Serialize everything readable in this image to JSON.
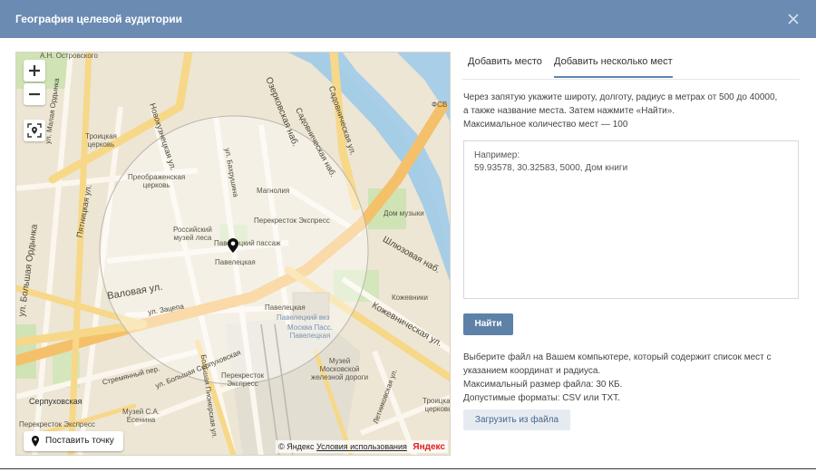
{
  "header": {
    "title": "География целевой аудитории",
    "close_icon": "close-icon"
  },
  "colors": {
    "header_bg": "#6b8bb3",
    "accent": "#5e81a8",
    "secondary_button_bg": "#e5ebf1",
    "yandex_red": "#e01e1e"
  },
  "map": {
    "zoom_in_icon": "plus-icon",
    "zoom_out_icon": "minus-icon",
    "locate_icon": "location-target-icon",
    "place_point_label": "Поставить точку",
    "attribution_prefix": "© Яндекс",
    "terms_label": "Условия использования",
    "brand": "Яндекс",
    "labels": {
      "ostrovskogo": "А.Н. Островского",
      "malaya_ordynka": "ул. Малая Ордынка",
      "troitskaya": "Троицкая\nцерковь",
      "preobr": "Преображенская\nцерковь",
      "magnolia": "Магнолия",
      "perekrestok1": "Перекресток Экспресс",
      "museum_forest": "Российский\nмузей леса",
      "paveletsky_passage": "Павелецкий пассаж",
      "paveletskaya": "Павелецкая",
      "paveletskaya2": "Павелецкая",
      "paveletsky_vokzal": "Павелецкий вкз",
      "moskva_pass": "Москва Пасс.\nПавелецкая",
      "dom_muzyki": "Дом музыки",
      "kozhevniki": "Кожевники",
      "fsv": "ФСВ",
      "museum_rail": "Музей\nМосковской\nжелезной дороги",
      "perekrestok2": "Перекресток\nЭкспресс",
      "serpukhovskaya": "Серпуховская",
      "perekrestok3": "Перекресток Экспресс",
      "museum_esenina": "Музей С.А.\nЕсенина",
      "troitskaya2": "Троицкая\nцерковь"
    },
    "roads": {
      "valovaya": "Валовая ул.",
      "novokuznetskaya": "Новокузнецкая ул.",
      "pyatnitskaya": "Пятницкая ул.",
      "bolshaya_ordynka": "ул. Большая Ордынка",
      "ozerkovskaya": "Озерковская наб.",
      "sadovnicheskaya": "Садовническая ул.",
      "sadovnicheskaya_nab": "Садовническая наб.",
      "shlyuzovaya": "Шлюзовая наб.",
      "kozhevnicheskaya": "Кожевническая ул.",
      "bakhrushina": "ул. Бахрушина",
      "zatsepa": "ул. Зацепа",
      "stremyanny": "Стремянный пер.",
      "bolshaya_serpukhovskaya": "ул. Большая Серпуховская",
      "letnikovskaya": "Летниковская ул.",
      "bolshaya_pionerskaya": "Большая Пионерская ул."
    }
  },
  "tabs": [
    {
      "label": "Добавить место",
      "active": false
    },
    {
      "label": "Добавить несколько мест",
      "active": true
    }
  ],
  "instructions": {
    "line1": "Через запятую укажите широту, долготу, радиус в метрах от 500 до 40000,",
    "line2": "а также название места. Затем нажмите «Найти».",
    "line3": "Максимальное количество мест — 100"
  },
  "textarea": {
    "placeholder_line1": "Например:",
    "placeholder_line2": "59.93578, 30.32583, 5000, Дом книги"
  },
  "find_button": "Найти",
  "file_info": {
    "line1": "Выберите файл на Вашем компьютере, который содержит список мест с",
    "line2": "указанием координат и радиуса.",
    "line3": "Максимальный размер файла: 30 КБ.",
    "line4": "Допустимые форматы: CSV или TXT."
  },
  "upload_button": "Загрузить из файла"
}
